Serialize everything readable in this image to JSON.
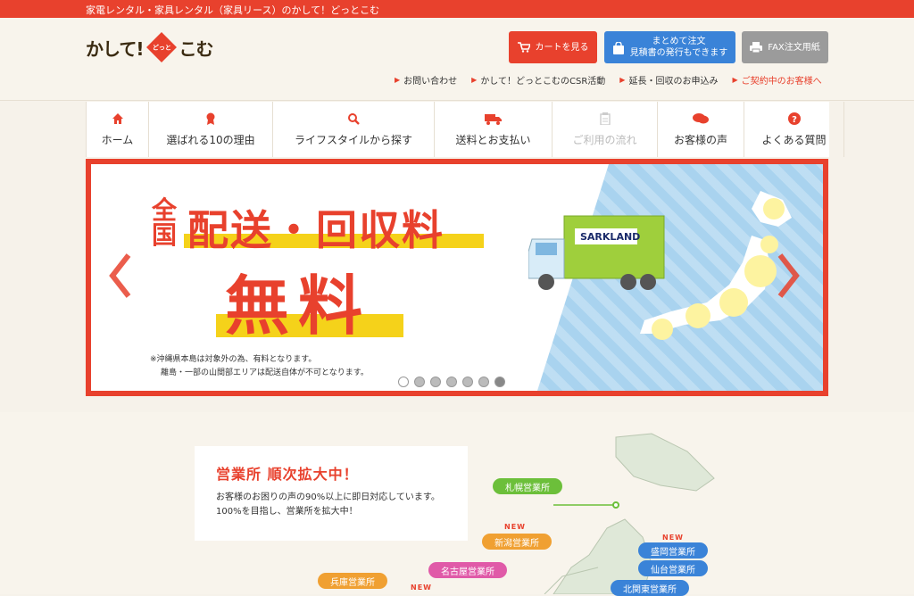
{
  "topbar": {
    "text": "家電レンタル・家具レンタル（家具リース）のかして！どっとこむ"
  },
  "logo": {
    "part1": "かして!",
    "mark": "どっと",
    "part2": "こむ"
  },
  "header_buttons": {
    "cart": "カートを見る",
    "estimate_line1": "まとめて注文",
    "estimate_line2": "見積書の発行もできます",
    "fax": "FAX注文用紙"
  },
  "header_links": [
    {
      "label": "お問い合わせ"
    },
    {
      "label": "かして！どっとこむのCSR活動"
    },
    {
      "label": "延長・回収のお申込み"
    },
    {
      "label": "ご契約中のお客様へ"
    }
  ],
  "nav": [
    {
      "label": "ホーム",
      "icon": "home-icon"
    },
    {
      "label": "選ばれる10の理由",
      "icon": "award-icon"
    },
    {
      "label": "ライフスタイルから探す",
      "icon": "search-icon"
    },
    {
      "label": "送料とお支払い",
      "icon": "truck-icon"
    },
    {
      "label": "ご利用の流れ",
      "icon": "clipboard-icon"
    },
    {
      "label": "お客様の声",
      "icon": "chat-icon"
    },
    {
      "label": "よくある質問",
      "icon": "question-icon"
    }
  ],
  "banner": {
    "zen": "全国",
    "headline": "配送・回収料",
    "free": "無料",
    "truck_brand": "SARKLAND",
    "note_line1": "※沖縄県本島は対象外の為、有料となります。",
    "note_line2": "離島・一部の山間部エリアは配送自体が不可となります。",
    "slide_count": 7,
    "active_slide": 7
  },
  "offices": {
    "title": "営業所 順次拡大中！",
    "text_line1": "お客様のお困りの声の90%以上に即日対応しています。",
    "text_line2": "100%を目指し、営業所を拡大中！",
    "new_label": "NEW",
    "tags": [
      {
        "label": "札幌営業所",
        "color": "#6cbf3a"
      },
      {
        "label": "新潟営業所",
        "color": "#f0a032"
      },
      {
        "label": "盛岡営業所",
        "color": "#3a83d8"
      },
      {
        "label": "仙台営業所",
        "color": "#3a83d8"
      },
      {
        "label": "名古屋営業所",
        "color": "#e05aa8"
      },
      {
        "label": "兵庫営業所",
        "color": "#f0a032"
      },
      {
        "label": "北関東営業所",
        "color": "#3a83d8"
      }
    ]
  }
}
